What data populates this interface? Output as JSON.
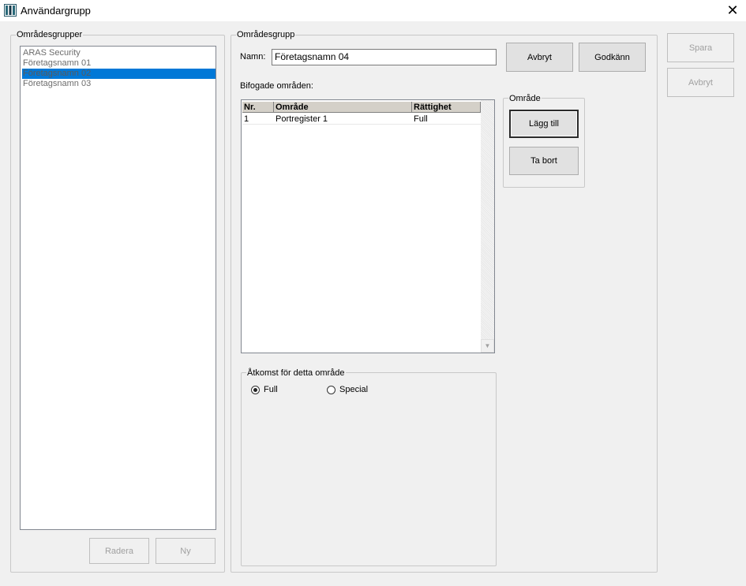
{
  "window": {
    "title": "Användargrupp",
    "close_glyph": "✕"
  },
  "left_panel": {
    "group_title": "Områdesgrupper",
    "items": [
      {
        "label": "ARAS Security"
      },
      {
        "label": "Företagsnamn 01"
      },
      {
        "label": "Företagsnamn 02"
      },
      {
        "label": "Företagsnamn 03"
      }
    ],
    "selected_index": 2,
    "delete_label": "Radera",
    "new_label": "Ny"
  },
  "main_panel": {
    "group_title": "Områdesgrupp",
    "name_label": "Namn:",
    "name_value": "Företagsnamn 04",
    "cancel_label": "Avbryt",
    "approve_label": "Godkänn",
    "attached_label": "Bifogade områden:",
    "table": {
      "headers": [
        "Nr.",
        "Område",
        "Rättighet"
      ],
      "rows": [
        [
          "1",
          "Portregister 1",
          "Full"
        ]
      ]
    },
    "area_group": {
      "title": "Område",
      "add_label": "Lägg till",
      "remove_label": "Ta bort"
    },
    "access_group": {
      "title": "Åtkomst för detta område",
      "options": [
        {
          "label": "Full",
          "checked": true
        },
        {
          "label": "Special",
          "checked": false
        }
      ]
    }
  },
  "side_buttons": {
    "save_label": "Spara",
    "cancel_label": "Avbryt"
  },
  "icons": {
    "app": "app-icon",
    "close": "close-icon",
    "scroll_down": "scroll-down-icon"
  },
  "colors": {
    "selection": "#0078d7",
    "title_bar": "#ffffff",
    "window_bg": "#f0f0f0"
  }
}
